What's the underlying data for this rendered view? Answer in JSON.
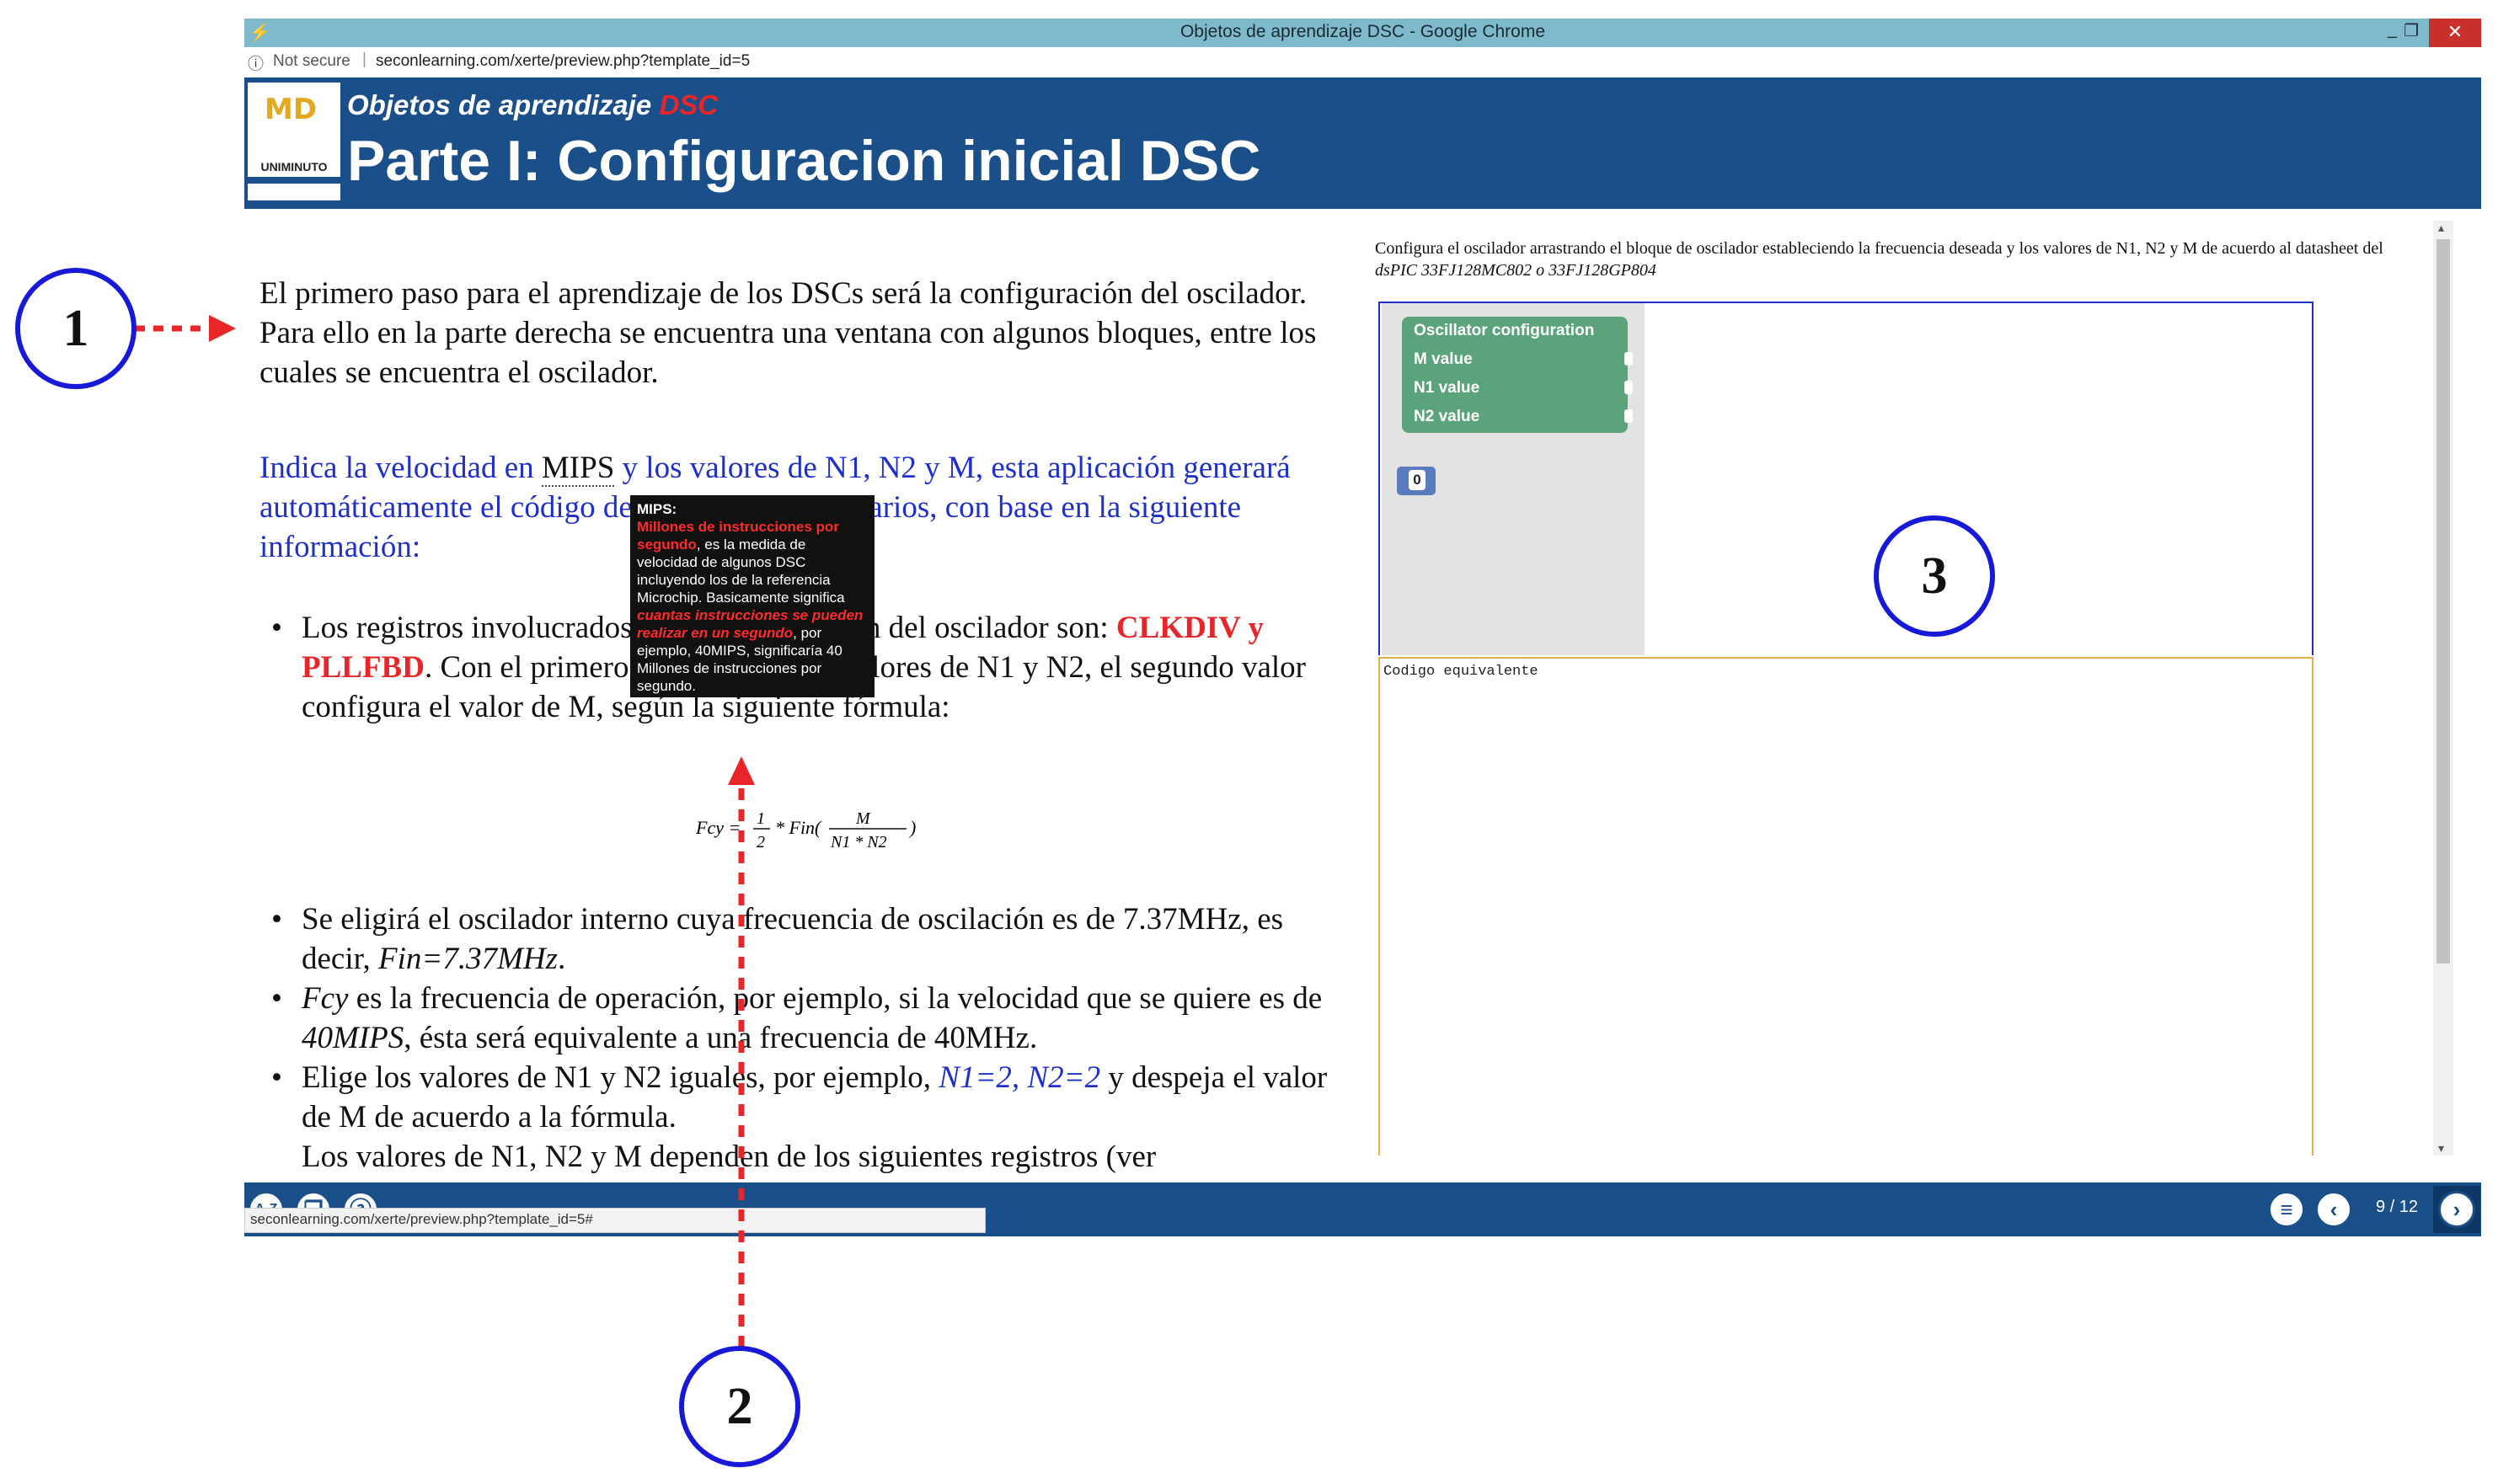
{
  "browser": {
    "window_title": "Objetos de aprendizaje DSC - Google Chrome",
    "not_secure": "Not secure",
    "url": "seconlearning.com/xerte/preview.php?template_id=5",
    "minimize": "_",
    "restore": "❐",
    "close": "✕"
  },
  "header": {
    "logo_text": "MD",
    "logo_sub": "UNIMINUTO",
    "subtitle_prefix": "Objetos de aprendizaje",
    "subtitle_accent": "DSC",
    "page_title": "Parte I: Configuracion inicial DSC"
  },
  "content": {
    "intro": "El primero paso para el aprendizaje de los DSCs será la configuración del oscilador. Para ello en la parte derecha se encuentra una ventana con algunos bloques, entre los cuales se encuentra el oscilador.",
    "instruction_a": "Indica la velocidad en ",
    "instruction_mips": "MIPS",
    "instruction_b": " y los valores de N1, N2 y M, esta aplicación generará automáticamente el código de los registros necesarios, con base en la siguiente información:",
    "bullet1_a": "Los registros involucrados en la configuración del oscilador son: ",
    "bullet1_red": "CLKDIV y PLLFBD",
    "bullet1_b": ". Con el primero se configura los valores de N1 y N2, el segundo valor configura el valor de M, según la siguiente fórmula:",
    "formula": "Fcy = 1/2 * Fin( M / (N1 * N2) )",
    "bullet2_a": "Se eligirá el oscilador interno cuya frecuencia de oscilación es de 7.37MHz, es decir, ",
    "bullet2_it": "Fin=7.37MHz",
    "bullet2_b": ".",
    "bullet3_it": "Fcy",
    "bullet3_a": " es la frecuencia de operación, por ejemplo, si la velocidad que se quiere es de ",
    "bullet3_it2": "40MIPS",
    "bullet3_b": ", ésta será equivalente a una frecuencia de 40MHz.",
    "bullet4_a": "Elige los valores de N1 y N2 iguales, por ejemplo, ",
    "bullet4_blue": "N1=2, N2=2",
    "bullet4_b": " y despeja el valor de M de acuerdo a la fórmula.",
    "bullet5": "Los valores de N1, N2 y M dependen de los siguientes registros (ver"
  },
  "tooltip": {
    "title": "MIPS:",
    "red": "Millones de instrucciones por segundo",
    "text1": ", es la medida de velocidad de algunos DSC incluyendo los de la referencia Microchip. Basicamente significa ",
    "red_italic": "cuantas instrucciones se pueden realizar en un segundo",
    "text2": ", por ejemplo, 40MIPS, significaría 40 Millones de instrucciones por segundo."
  },
  "panel": {
    "instruction_a": "Configura el oscilador arrastrando el bloque de oscilador estableciendo la frecuencia deseada y los valores de N1, N2 y M de acuerdo al datasheet del ",
    "instruction_it": "dsPIC 33FJ128MC802 o 33FJ128GP804",
    "block_title": "Oscillator configuration",
    "block_m": "M value",
    "block_n1": "N1 value",
    "block_n2": "N2 value",
    "number_block": "0",
    "code_label": "Codigo equivalente"
  },
  "footer": {
    "page_indicator": "9 / 12",
    "status_url": "seconlearning.com/xerte/preview.php?template_id=5#"
  },
  "annotations": {
    "marker1": "1",
    "marker2": "2",
    "marker3": "3",
    "color": "#1818d8",
    "arrow_color": "#e8262a"
  },
  "colors": {
    "header_bg": "#1a4f8a",
    "accent_red": "#e8262a",
    "link_blue": "#1f2fc9",
    "block_green": "#5ba37a"
  }
}
